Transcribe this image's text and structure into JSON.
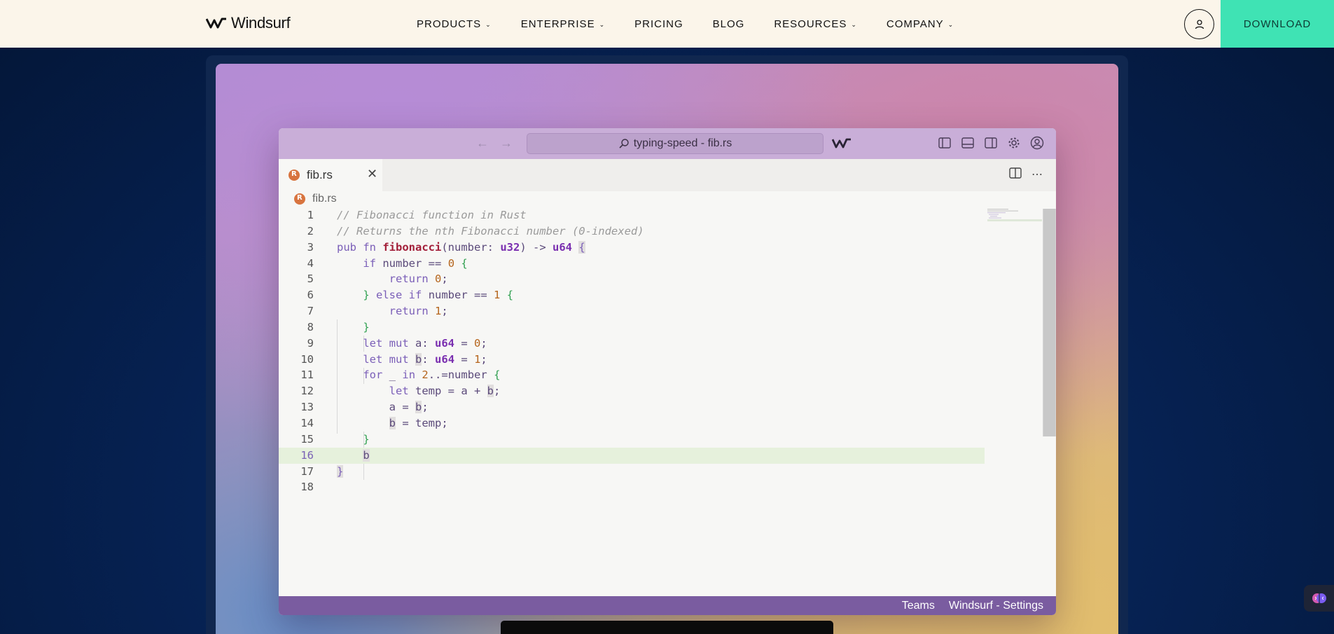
{
  "header": {
    "brand": "Windsurf",
    "nav": [
      {
        "label": "PRODUCTS",
        "dropdown": true
      },
      {
        "label": "ENTERPRISE",
        "dropdown": true
      },
      {
        "label": "PRICING",
        "dropdown": false
      },
      {
        "label": "BLOG",
        "dropdown": false
      },
      {
        "label": "RESOURCES",
        "dropdown": true
      },
      {
        "label": "COMPANY",
        "dropdown": true
      }
    ],
    "user_icon": "user-icon",
    "download_label": "DOWNLOAD",
    "colors": {
      "header_bg": "#fbf5ea",
      "download_bg": "#3fe3b4",
      "page_bg": "#062356"
    }
  },
  "editor": {
    "search_text": "typing-speed - fib.rs",
    "tab_label": "fib.rs",
    "breadcrumb": "fib.rs",
    "status": {
      "teams": "Teams",
      "settings": "Windsurf - Settings"
    },
    "active_line": 16,
    "line_numbers": [
      "1",
      "2",
      "3",
      "4",
      "5",
      "6",
      "7",
      "8",
      "9",
      "10",
      "11",
      "12",
      "13",
      "14",
      "15",
      "16",
      "17",
      "18"
    ],
    "colors": {
      "titlebar": "#c9aed8",
      "statusbar": "#7a5ca0",
      "active_line": "#e6f1dc"
    }
  }
}
